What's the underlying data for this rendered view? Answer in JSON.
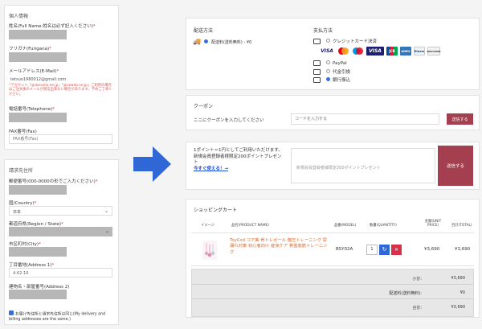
{
  "personal": {
    "title": "個人情報",
    "name_label": "姓名(Full Name:姓名は必ず記入ください)",
    "furigana_label": "フリガナ(Furigana)",
    "email_label": "メールアドレス(E-Mail)",
    "email_value": "tetsuo1980012@gmail.com",
    "email_note": "*アカウント「@docomo.ne.jp」「@ezweb.ne.jp」ご利用の場合はご注文後のメールが受信出来ない場合があります。予めご了承ください。",
    "phone_label": "電話番号(Telephone)",
    "fax_label": "FAX番号(Fax)",
    "fax_placeholder": "FAX番号(Fax)"
  },
  "billing": {
    "title": "請求先住所",
    "postal_label": "郵便番号(000-0000の形でご入力ください)",
    "country_label": "国(Country)",
    "country_value": "日本",
    "region_label": "都道府県(Region / State)",
    "city_label": "市区町村(City)",
    "address1_label": "丁目番地(Address 1)",
    "address1_value": "4-62-16",
    "address2_label": "建物名・部屋番号(Address 2)",
    "same_address_label": "お届け先住所と請求先住所は同じ(My delivery and billing addresses are the same.)"
  },
  "shipping": {
    "title": "配送方法",
    "option": "配送料(送料無料) - ¥0"
  },
  "payment": {
    "title": "支払方法",
    "credit": "クレジットカード決済",
    "cards": [
      "VISA",
      "MC",
      "VISA",
      "JCB",
      "AMEX",
      "Diners",
      "DISCOVER"
    ],
    "paypal": "PayPal",
    "cod": "代金引換",
    "bank": "銀行振込"
  },
  "coupon": {
    "title": "クーポン",
    "prompt": "ここにクーポンを入力してください",
    "placeholder": "コードを入力する",
    "button": "送信する"
  },
  "points": {
    "line1": "1ポイント＝1円としてご利用いただけます。",
    "line2": "新規会員登録者様限定200ポイントプレゼント",
    "link": "今すぐ使える！→",
    "placeholder": "新規会員登録者様限定200ポイントプレゼント",
    "button": "送信する"
  },
  "cart": {
    "title": "ショッピングカート",
    "headers": {
      "image": "イメージ",
      "product": "品名(PRODUCT NAME)",
      "model": "品番(MODEL)",
      "qty": "数量(QUANTITY)",
      "unit": "金額(UNIT PRICE)",
      "total": "合計(TOTAL)"
    },
    "item": {
      "name": "ToyCod コア美 骨トレボール 膣圧トレーニング 尿漏れ対策 初心者向け 産後ケア 骨盤底筋トレーニング",
      "model": "BSY02A",
      "qty": "1",
      "unit": "¥3,690",
      "total": "¥3,690"
    },
    "summary": [
      {
        "label": "小計:",
        "value": "¥3,690"
      },
      {
        "label": "配送料(送料無料):",
        "value": "¥0"
      },
      {
        "label": "合計:",
        "value": "¥3,690"
      }
    ]
  },
  "colors": {
    "accent": "#a33f4f",
    "blue": "#3b6fd6",
    "link_blue": "#1f4fd0",
    "warn": "#d9534f",
    "product_name": "#e06a2a"
  }
}
